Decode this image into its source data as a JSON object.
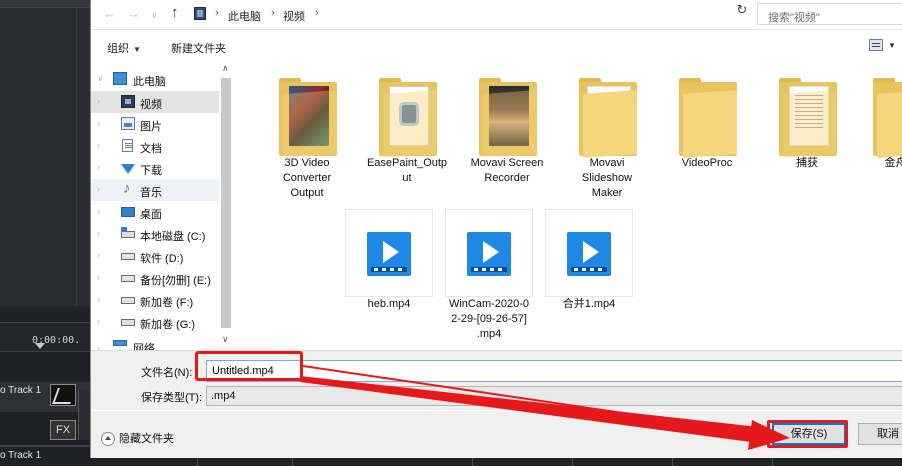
{
  "background_app": {
    "timecode": "0:00:00.",
    "track1_label": "o Track 1",
    "track2_label": "o Track 1",
    "fx_label": "FX"
  },
  "dialog": {
    "nav": {
      "back_icon": "arrow-left-icon",
      "forward_icon": "arrow-right-icon",
      "recent_icon": "chevron-down-icon",
      "up_icon": "arrow-up-icon"
    },
    "path": [
      "此电脑",
      "视频"
    ],
    "search_placeholder": "搜索\"视频\"",
    "commands": {
      "organize": "组织",
      "new_folder": "新建文件夹"
    },
    "nav_tree": [
      {
        "label": "此电脑",
        "icon": "computer-icon",
        "indent": 0,
        "state": "normal"
      },
      {
        "label": "视频",
        "icon": "video-folder-icon",
        "indent": 1,
        "state": "selected"
      },
      {
        "label": "图片",
        "icon": "pictures-icon",
        "indent": 1,
        "state": "normal"
      },
      {
        "label": "文档",
        "icon": "documents-icon",
        "indent": 1,
        "state": "normal"
      },
      {
        "label": "下载",
        "icon": "download-icon",
        "indent": 1,
        "state": "normal"
      },
      {
        "label": "音乐",
        "icon": "music-icon",
        "indent": 1,
        "state": "hover"
      },
      {
        "label": "桌面",
        "icon": "desktop-icon",
        "indent": 1,
        "state": "normal"
      },
      {
        "label": "本地磁盘 (C:)",
        "icon": "system-drive-icon",
        "indent": 1,
        "state": "normal"
      },
      {
        "label": "软件 (D:)",
        "icon": "drive-icon",
        "indent": 1,
        "state": "normal"
      },
      {
        "label": "备份[勿删] (E:)",
        "icon": "drive-icon",
        "indent": 1,
        "state": "normal"
      },
      {
        "label": "新加卷 (F:)",
        "icon": "drive-icon",
        "indent": 1,
        "state": "normal"
      },
      {
        "label": "新加卷 (G:)",
        "icon": "drive-icon",
        "indent": 1,
        "state": "normal"
      },
      {
        "label": "网络",
        "icon": "network-icon",
        "indent": 0,
        "state": "normal"
      }
    ],
    "folders": [
      {
        "name": "3D Video Converter Output",
        "lines": [
          "3D Video",
          "Converter",
          "Output"
        ],
        "thumb": "3d"
      },
      {
        "name": "EasePaint_Output",
        "lines": [
          "EasePaint_Outp",
          "ut"
        ],
        "thumb": "ease"
      },
      {
        "name": "Movavi Screen Recorder",
        "lines": [
          "Movavi Screen",
          "Recorder"
        ],
        "thumb": "movavi"
      },
      {
        "name": "Movavi Slideshow Maker",
        "lines": [
          "Movavi",
          "Slideshow",
          "Maker"
        ],
        "thumb": "none"
      },
      {
        "name": "VideoProc",
        "lines": [
          "VideoProc"
        ],
        "thumb": "none"
      },
      {
        "name": "捕获",
        "lines": [
          "捕获"
        ],
        "thumb": "lines"
      },
      {
        "name": "金舟录",
        "lines": [
          "金舟录"
        ],
        "thumb": "none"
      }
    ],
    "files": [
      {
        "lines": [
          "heb.mp4"
        ]
      },
      {
        "lines": [
          "WinCam-2020-0",
          "2-29-[09-26-57]",
          ".mp4"
        ]
      },
      {
        "lines": [
          "合并1.mp4"
        ]
      }
    ],
    "filename_label": "文件名(N):",
    "filename_value": "Untitled.mp4",
    "filetype_label": "保存类型(T):",
    "filetype_value": ".mp4",
    "hide_folders": "隐藏文件夹",
    "save_button": "保存(S)",
    "cancel_button": "取消"
  },
  "annotation_color": "#e5191b"
}
